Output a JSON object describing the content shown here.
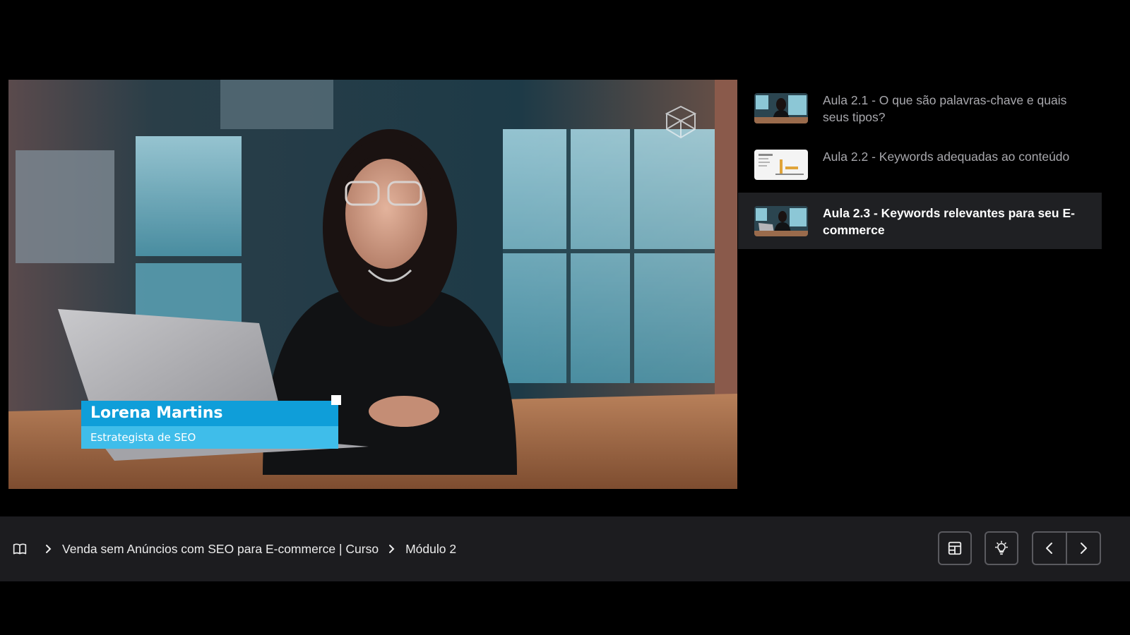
{
  "video": {
    "presenter_name": "Lorena Martins",
    "presenter_role": "Estrategista de SEO"
  },
  "playlist": {
    "lessons": [
      {
        "title": "Aula 2.1 - O que são palavras-chave e quais seus tipos?",
        "active": false
      },
      {
        "title": "Aula 2.2 - Keywords adequadas ao conteúdo",
        "active": false
      },
      {
        "title": "Aula 2.3 - Keywords relevantes para seu E-commerce",
        "active": true
      }
    ]
  },
  "breadcrumb": {
    "icon": "book-icon",
    "course": "Venda sem Anúncios com SEO para E-commerce | Curso",
    "module": "Módulo 2"
  },
  "controls": {
    "layout_icon": "layout-icon",
    "theme_icon": "lightbulb-icon",
    "prev_icon": "chevron-left-icon",
    "next_icon": "chevron-right-icon"
  },
  "colors": {
    "background": "#000000",
    "bar": "#1c1c1f",
    "active_row": "#1f2023",
    "lower_third_name": "#0f9ed9",
    "lower_third_role": "#3fbdea"
  }
}
